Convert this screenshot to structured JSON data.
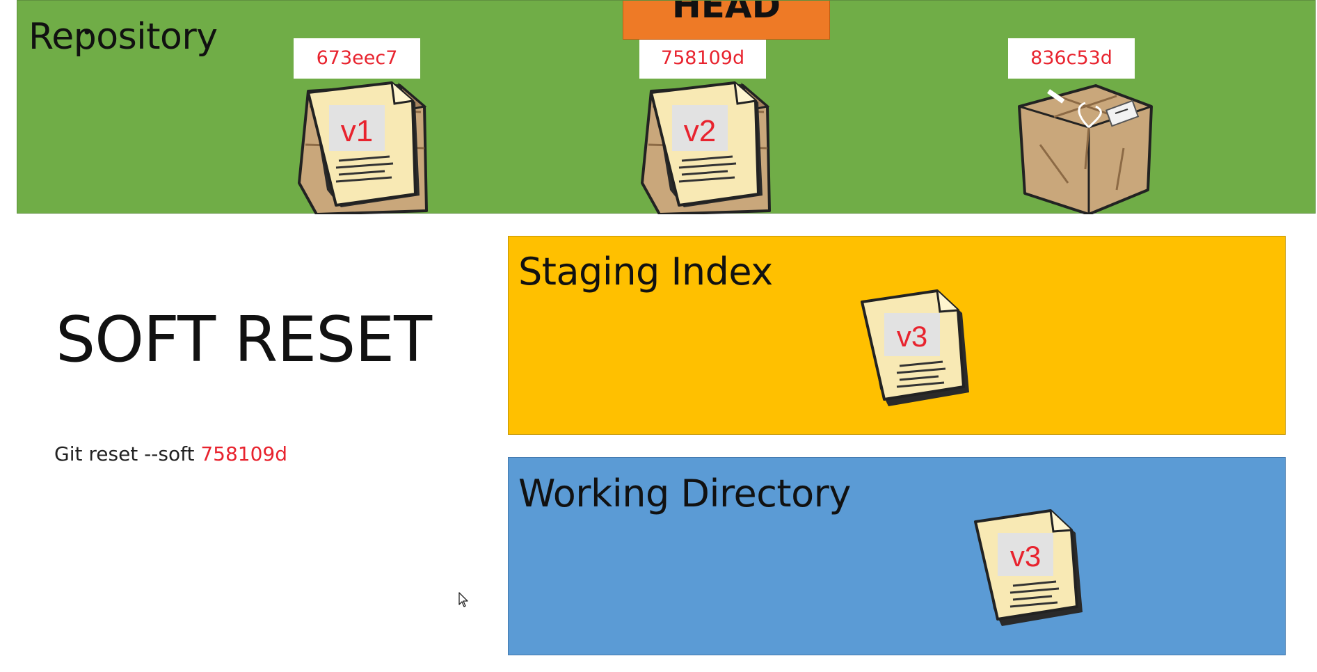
{
  "repository": {
    "title": "Repository",
    "head_label": "HEAD",
    "commits": [
      {
        "hash": "673eec7",
        "version": "v1"
      },
      {
        "hash": "758109d",
        "version": "v2"
      },
      {
        "hash": "836c53d",
        "version": ""
      }
    ]
  },
  "staging_index": {
    "title": "Staging Index",
    "file_version": "v3"
  },
  "working_directory": {
    "title": "Working Directory",
    "file_version": "v3"
  },
  "reset": {
    "title": "SOFT RESET",
    "command_text": "Git reset --soft",
    "command_hash": "758109d"
  },
  "colors": {
    "repository_bg": "#70ad47",
    "staging_bg": "#ffc000",
    "working_bg": "#5b9bd5",
    "head_bg": "#ee7a26",
    "hash_text": "#e8232e"
  },
  "icons": [
    "package-icon",
    "document-icon",
    "mouse-pointer-icon"
  ]
}
